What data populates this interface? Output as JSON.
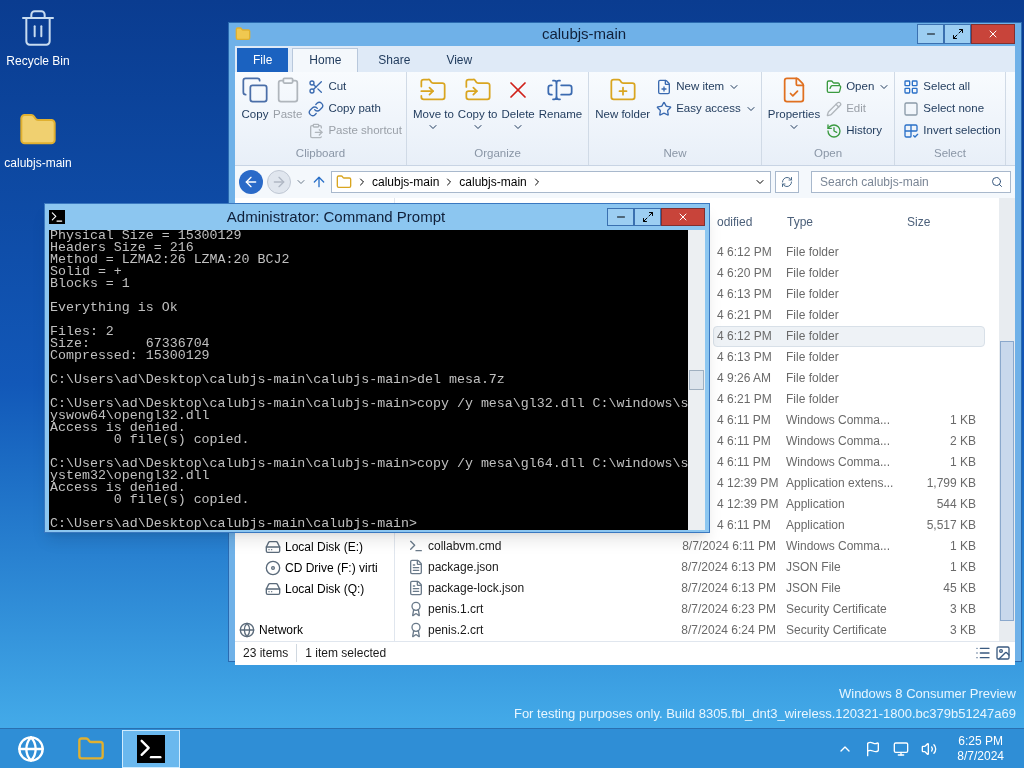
{
  "desktop_icons": [
    {
      "label": "Recycle Bin",
      "kind": "recycle"
    },
    {
      "label": "calubjs-main",
      "kind": "folder"
    }
  ],
  "explorer": {
    "title": "calubjs-main",
    "tabs": [
      {
        "label": "File",
        "kind": "file",
        "selected": false
      },
      {
        "label": "Home",
        "kind": "tab",
        "selected": true
      },
      {
        "label": "Share",
        "kind": "tab",
        "selected": false
      },
      {
        "label": "View",
        "kind": "tab",
        "selected": false
      }
    ],
    "ribbon_groups": [
      {
        "label": "Clipboard",
        "items": [
          {
            "label": "Copy",
            "kind": "large",
            "disabled": false
          },
          {
            "label": "Paste",
            "kind": "large",
            "disabled": true
          },
          {
            "label": "Cut",
            "kind": "small",
            "disabled": false
          },
          {
            "label": "Copy path",
            "kind": "small",
            "disabled": false
          },
          {
            "label": "Paste shortcut",
            "kind": "small",
            "disabled": true
          }
        ]
      },
      {
        "label": "Organize",
        "items": [
          {
            "label": "Move to",
            "kind": "large",
            "disabled": false,
            "dropdown": true
          },
          {
            "label": "Copy to",
            "kind": "large",
            "disabled": false,
            "dropdown": true
          },
          {
            "label": "Delete",
            "kind": "large",
            "disabled": false,
            "dropdown": true
          },
          {
            "label": "Rename",
            "kind": "large",
            "disabled": false
          }
        ]
      },
      {
        "label": "New",
        "items": [
          {
            "label": "New folder",
            "kind": "large",
            "disabled": false
          },
          {
            "label": "New item",
            "kind": "small",
            "disabled": false,
            "dropdown": true
          },
          {
            "label": "Easy access",
            "kind": "small",
            "disabled": false,
            "dropdown": true
          }
        ]
      },
      {
        "label": "Open",
        "items": [
          {
            "label": "Properties",
            "kind": "large",
            "disabled": false,
            "dropdown": true
          },
          {
            "label": "Open",
            "kind": "small",
            "disabled": false,
            "dropdown": true
          },
          {
            "label": "Edit",
            "kind": "small",
            "disabled": true
          },
          {
            "label": "History",
            "kind": "small",
            "disabled": false
          }
        ]
      },
      {
        "label": "Select",
        "items": [
          {
            "label": "Select all",
            "kind": "small",
            "disabled": false
          },
          {
            "label": "Select none",
            "kind": "small",
            "disabled": false
          },
          {
            "label": "Invert selection",
            "kind": "small",
            "disabled": false
          }
        ]
      }
    ],
    "breadcrumbs": [
      "calubjs-main",
      "calubjs-main"
    ],
    "search": {
      "placeholder": "Search calubjs-main"
    },
    "nav_items": [
      {
        "label": "Local Disk (E:)",
        "kind": "drive"
      },
      {
        "label": "CD Drive (F:) virti",
        "kind": "cd"
      },
      {
        "label": "Local Disk (Q:)",
        "kind": "drive"
      },
      {
        "label": "Network",
        "kind": "network"
      }
    ],
    "columns": [
      "odified",
      "Type",
      "Size"
    ],
    "rows": [
      {
        "modified": "4 6:12 PM",
        "type": "File folder",
        "selected": false
      },
      {
        "modified": "4 6:20 PM",
        "type": "File folder",
        "selected": false
      },
      {
        "modified": "4 6:13 PM",
        "type": "File folder",
        "selected": false
      },
      {
        "modified": "4 6:21 PM",
        "type": "File folder",
        "selected": false
      },
      {
        "modified": "4 6:12 PM",
        "type": "File folder",
        "selected": true
      },
      {
        "modified": "4 6:13 PM",
        "type": "File folder",
        "selected": false
      },
      {
        "modified": "4 9:26 AM",
        "type": "File folder",
        "selected": false
      },
      {
        "modified": "4 6:21 PM",
        "type": "File folder",
        "selected": false
      },
      {
        "modified": "4 6:11 PM",
        "type": "Windows Comma...",
        "size": "1 KB",
        "selected": false
      },
      {
        "modified": "4 6:11 PM",
        "type": "Windows Comma...",
        "size": "2 KB",
        "selected": false
      },
      {
        "modified": "4 6:11 PM",
        "type": "Windows Comma...",
        "size": "1 KB",
        "selected": false
      },
      {
        "modified": "4 12:39 PM",
        "type": "Application extens...",
        "size": "1,799 KB",
        "selected": false
      },
      {
        "modified": "4 12:39 PM",
        "type": "Application",
        "size": "544 KB",
        "selected": false
      },
      {
        "modified": "4 6:11 PM",
        "type": "Application",
        "size": "5,517 KB",
        "selected": false
      },
      {
        "name": "collabvm.cmd",
        "kind": "cmd",
        "modified": "8/7/2024 6:11 PM",
        "type": "Windows Comma...",
        "size": "1 KB",
        "selected": false
      },
      {
        "name": "package.json",
        "kind": "file",
        "modified": "8/7/2024 6:13 PM",
        "type": "JSON File",
        "size": "1 KB",
        "selected": false
      },
      {
        "name": "package-lock.json",
        "kind": "file",
        "modified": "8/7/2024 6:13 PM",
        "type": "JSON File",
        "size": "45 KB",
        "selected": false
      },
      {
        "name": "penis.1.crt",
        "kind": "cert",
        "modified": "8/7/2024 6:23 PM",
        "type": "Security Certificate",
        "size": "3 KB",
        "selected": false
      },
      {
        "name": "penis.2.crt",
        "kind": "cert",
        "modified": "8/7/2024 6:24 PM",
        "type": "Security Certificate",
        "size": "3 KB",
        "selected": false
      }
    ],
    "status": [
      "23 items",
      "1 item selected"
    ]
  },
  "console": {
    "title": "Administrator: Command Prompt",
    "blocks": [
      [
        "Physical Size = 15300129",
        "Headers Size = 216",
        "Method = LZMA2:26 LZMA:20 BCJ2",
        "Solid = +",
        "Blocks = 1"
      ],
      [
        "Everything is Ok"
      ],
      [
        "Files: 2",
        "Size:       67336704",
        "Compressed: 15300129"
      ],
      [
        "C:\\Users\\ad\\Desktop\\calubjs-main\\calubjs-main>del mesa.7z"
      ],
      [
        "C:\\Users\\ad\\Desktop\\calubjs-main\\calubjs-main>copy /y mesa\\gl32.dll C:\\windows\\s",
        "yswow64\\opengl32.dll",
        "Access is denied.",
        "        0 file(s) copied."
      ],
      [
        "C:\\Users\\ad\\Desktop\\calubjs-main\\calubjs-main>copy /y mesa\\gl64.dll C:\\windows\\s",
        "ystem32\\opengl32.dll",
        "Access is denied.",
        "        0 file(s) copied."
      ],
      [
        "C:\\Users\\ad\\Desktop\\calubjs-main\\calubjs-main>"
      ]
    ]
  },
  "watermark": [
    "Windows 8 Consumer Preview",
    "For testing purposes only. Build 8305.fbl_dnt3_wireless.120321-1800.bc379b51247a69"
  ],
  "taskbar": {
    "apps": [
      {
        "kind": "browser",
        "selected": false
      },
      {
        "kind": "explorer",
        "selected": false
      },
      {
        "kind": "console",
        "selected": true
      }
    ],
    "time": "6:25 PM",
    "date": "8/7/2024"
  }
}
